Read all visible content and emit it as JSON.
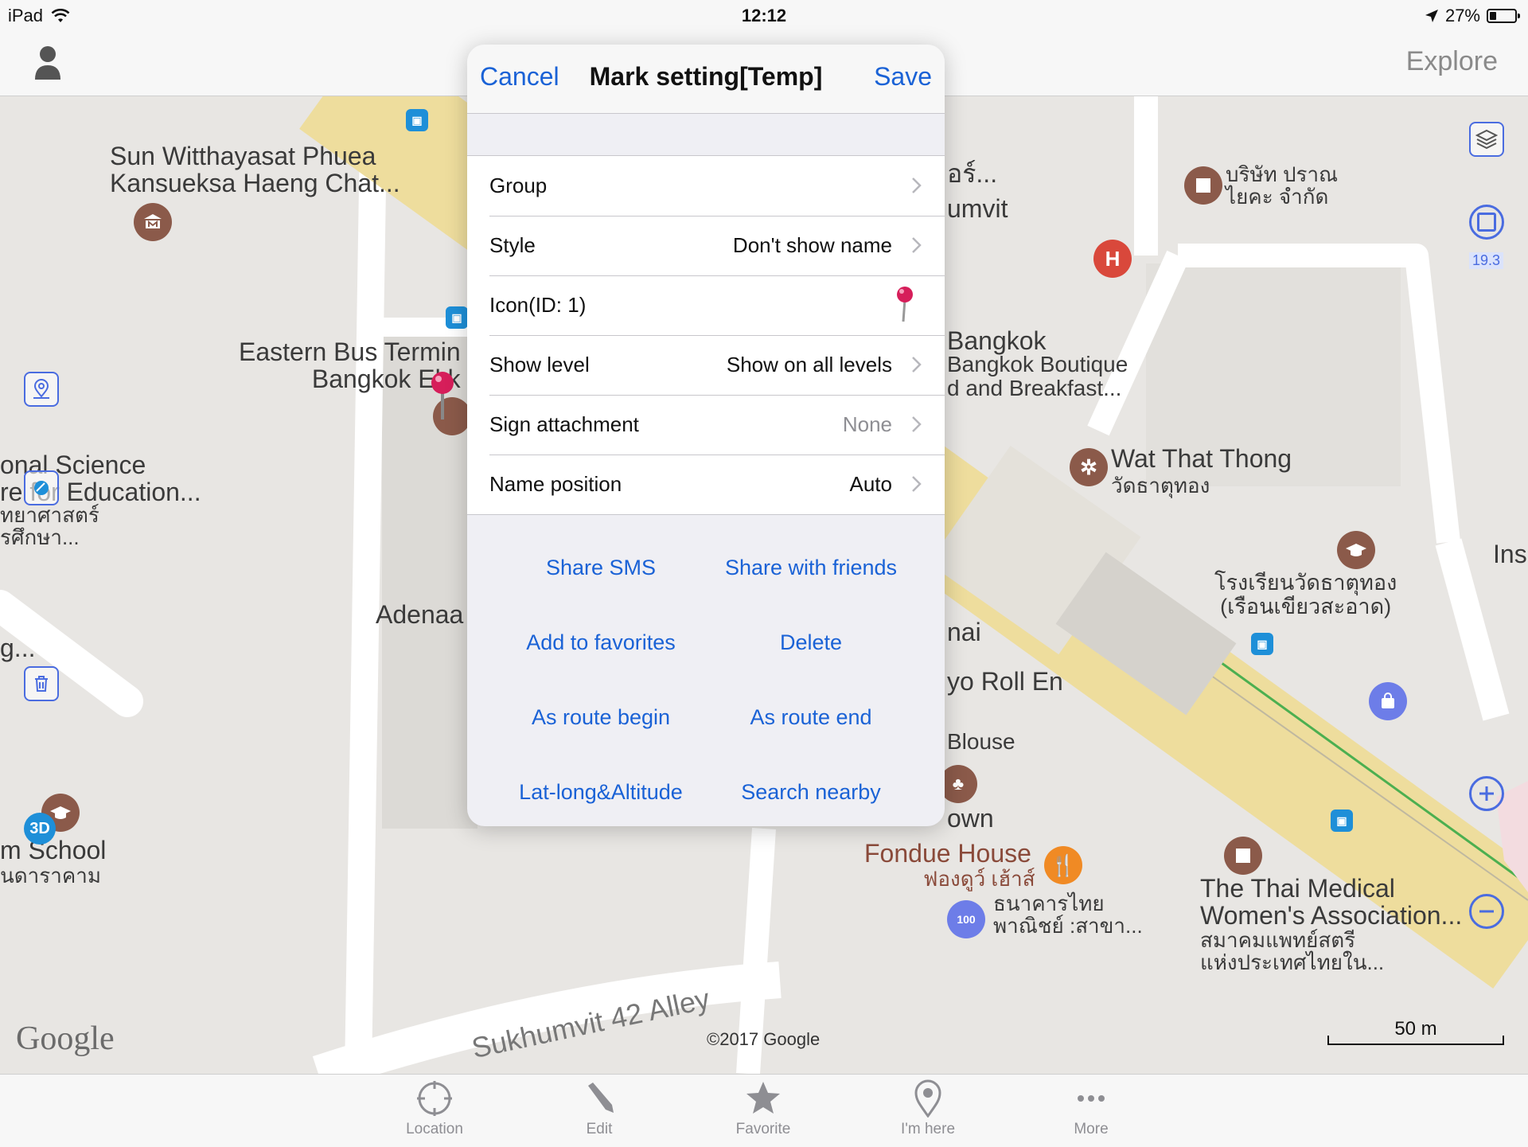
{
  "status_bar": {
    "device": "iPad",
    "time": "12:12",
    "battery": "27%",
    "battery_level": 0.27
  },
  "top_bar": {
    "explore_label": "Explore"
  },
  "map": {
    "zoom_level": "19.3",
    "labels": {
      "school_name_line1": "Sun Witthayasat Phuea",
      "school_name_line2": "Kansueksa Haeng Chat...",
      "bus_terminal_line1": "Eastern Bus Termin",
      "bus_terminal_line2": "Bangkok Ekk",
      "science_line1": "onal Science",
      "science_line2": "re for Education...",
      "science_thai_line1": "ทยาศาสตร์",
      "science_thai_line2": "รศึกษา...",
      "adenaa": "Adenaa",
      "left_g": "g...",
      "m_school": "m School",
      "m_school_thai": "นดาราคาม",
      "top_thai_company_line1": "บริษัท ปราณ",
      "top_thai_company_line2": "ไยคะ จำกัด",
      "right_a": "อร์...",
      "umvit": "umvit",
      "bangkok": "Bangkok",
      "boutique_line1": "Bangkok Boutique",
      "boutique_line2": "d and Breakfast...",
      "wat_that_thong": "Wat That Thong",
      "wat_thai": "วัดธาตุทอง",
      "ins": "Ins",
      "school_thai_line1": "โรงเรียนวัดธาตุทอง",
      "school_thai_line2": "(เรือนเขียวสะอาด)",
      "nai": "nai",
      "yo_roll": "yo Roll En",
      "blouse": "Blouse",
      "town": "own",
      "fondue": "Fondue House",
      "fondue_thai": "ฟองดูว์ เฮ้าส์",
      "bank_line1": "ธนาคารไทย",
      "bank_line2": "พาณิชย์ :สาขา...",
      "thai_medical_line1": "The Thai Medical",
      "thai_medical_line2": "Women's Association...",
      "thai_medical_thai_line1": "สมาคมแพทย์สตรี",
      "thai_medical_thai_line2": "แห่งประเทศไทยใน...",
      "street": "Sukhumvit 42 Alley",
      "three_d": "3D"
    },
    "google": "Google",
    "copyright": "©2017 Google",
    "scale": "50 m",
    "colors": {
      "road_major": "#f3e3a6",
      "road_minor": "#ffffff",
      "poi_brown": "#8b5a4a",
      "hospital_red": "#d9483b",
      "accent_blue": "#4a6ce0"
    }
  },
  "sheet": {
    "cancel_label": "Cancel",
    "title": "Mark setting[Temp]",
    "save_label": "Save",
    "rows": [
      {
        "label": "Group",
        "value": ""
      },
      {
        "label": "Style",
        "value": "Don't show name"
      },
      {
        "label": "Icon(ID: 1)",
        "value": ""
      },
      {
        "label": "Show level",
        "value": "Show on all levels"
      },
      {
        "label": "Sign attachment",
        "value": "None"
      },
      {
        "label": "Name position",
        "value": "Auto"
      }
    ],
    "actions": [
      "Share SMS",
      "Share with friends",
      "Add to favorites",
      "Delete",
      "As route begin",
      "As route end",
      "Lat-long&Altitude",
      "Search nearby"
    ],
    "accent_color": "#1a62d6"
  },
  "tab_bar": {
    "tabs": [
      {
        "label": "Location",
        "icon": "crosshair-icon"
      },
      {
        "label": "Edit",
        "icon": "pencil-icon"
      },
      {
        "label": "Favorite",
        "icon": "star-icon"
      },
      {
        "label": "I'm here",
        "icon": "pin-icon"
      },
      {
        "label": "More",
        "icon": "more-icon"
      }
    ]
  }
}
